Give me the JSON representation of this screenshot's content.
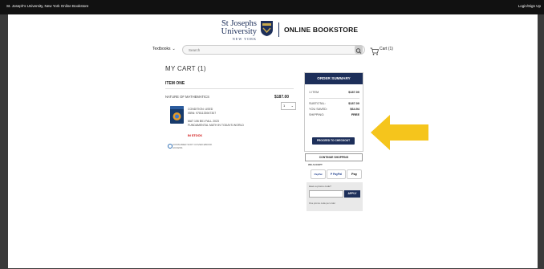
{
  "topbar": {
    "site_name": "St. Joseph's University, New York Online Bookstore",
    "login": "Login/Sign Up"
  },
  "header": {
    "university_line1": "St Josephs",
    "university_line2": "University",
    "university_line3": "NEW YORK",
    "store_name": "ONLINE BOOKSTORE"
  },
  "search": {
    "category": "Textbooks",
    "placeholder": "Search"
  },
  "cart_link": "Cart (1)",
  "cart": {
    "heading": "MY CART (1)",
    "item_heading": "ITEM ONE",
    "item": {
      "title": "NATURE OF MATHEMATICS",
      "price": "$187.00",
      "qty": "1",
      "condition": "CONDITION: USED",
      "isbn": "ISBN: 9781133947307",
      "course": "MAT 106 B01 FALL 2023",
      "course_desc": "FUNDAMENTAL MATH IN TODAYS WORLD",
      "stock": "IN STOCK"
    },
    "consent_text": "CONSUMER SOFT COVER EBOOK ACCESS"
  },
  "summary": {
    "title": "ORDER SUMMARY",
    "items_label": "1 ITEM",
    "items_value": "$187.00",
    "subtotal_label": "SUBTOTAL:",
    "subtotal_value": "$187.00",
    "saved_label": "YOU SAVED:",
    "saved_value": "$64.94",
    "shipping_label": "SHIPPING:",
    "shipping_value": "FREE",
    "checkout": "PROCEED TO CHECKOUT"
  },
  "continue": "CONTINUE SHOPPING",
  "accept_label": "WE ACCEPT",
  "payments": [
    "PayPal",
    "P PayPal",
    "Pay"
  ],
  "promo": {
    "label": "Have a promo code?",
    "apply": "APPLY",
    "note": "One promo code per order"
  },
  "colors": {
    "brand_navy": "#1d2f5a",
    "arrow_yellow": "#f5c51c",
    "stock_red": "#cc0000"
  }
}
